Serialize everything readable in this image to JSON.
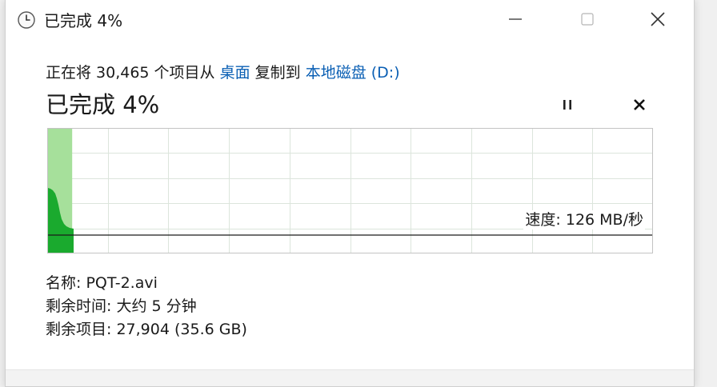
{
  "window": {
    "title": "已完成 4%",
    "title_icon": "clock-icon",
    "controls": {
      "minimize": "minimize-icon",
      "maximize": "maximize-icon",
      "close": "close-icon"
    }
  },
  "copy": {
    "prefix": "正在将 30,465 个项目从 ",
    "source": "桌面",
    "middle": " 复制到 ",
    "destination": "本地磁盘 (D:)"
  },
  "status": {
    "title": "已完成 4%",
    "progress_percent": 4,
    "pause_icon": "pause-icon",
    "cancel_icon": "cancel-icon"
  },
  "graph": {
    "speed_label": "速度: 126 MB/秒",
    "fill_color": "#a6e09b",
    "speed_color": "#1aaa2e",
    "grid_color": "#dce5dc",
    "border_color": "#c3c3c3"
  },
  "details": {
    "name_label": "名称: ",
    "name_value": "PQT-2.avi",
    "time_label": "剩余时间: ",
    "time_value": "大约 5 分钟",
    "items_label": "剩余项目: ",
    "items_value": "27,904 (35.6 GB)"
  },
  "colors": {
    "link": "#0a5fb4",
    "text": "#1a1a1a"
  }
}
